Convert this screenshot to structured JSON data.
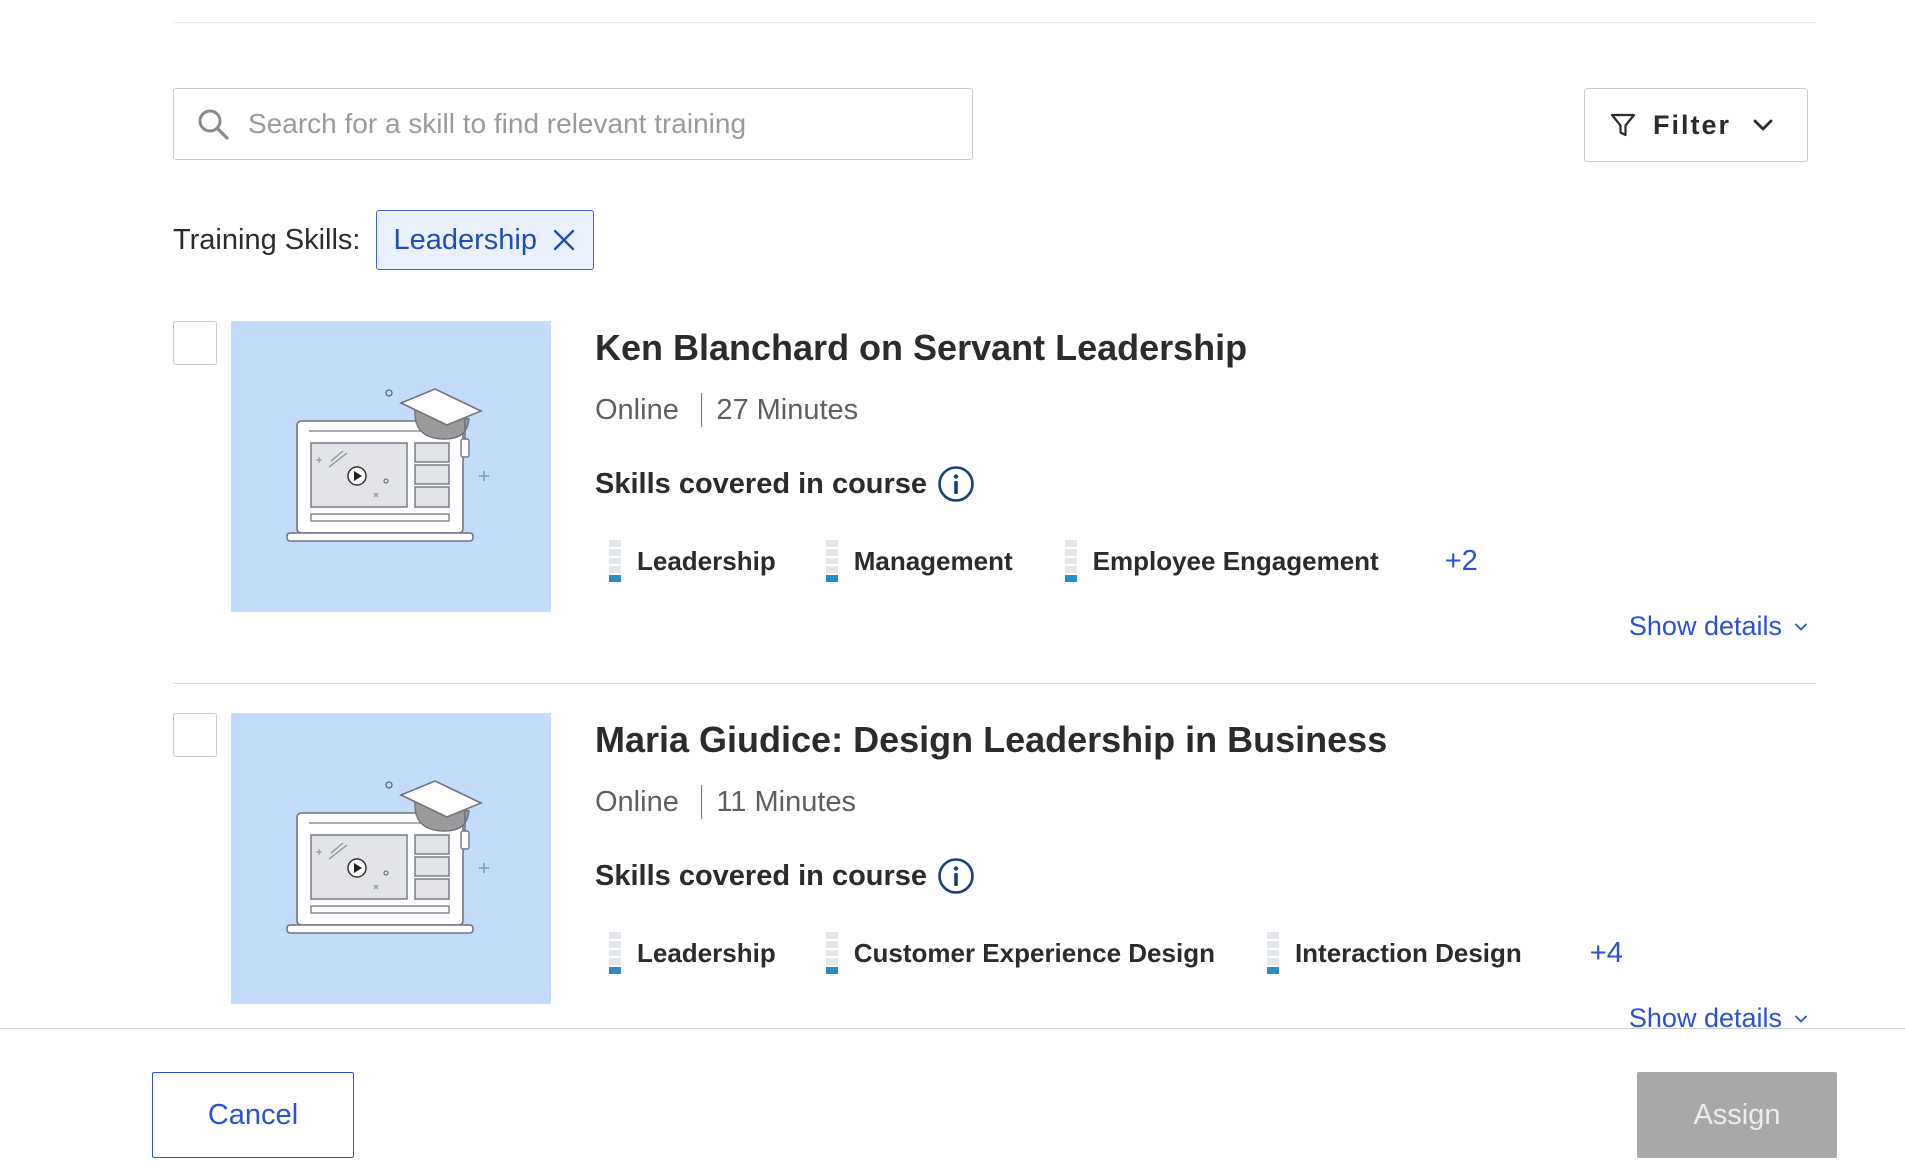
{
  "search": {
    "placeholder": "Search for a skill to find relevant training",
    "value": ""
  },
  "filter": {
    "label": "Filter"
  },
  "training_skills": {
    "label": "Training Skills:",
    "chips": [
      {
        "label": "Leadership"
      }
    ]
  },
  "courses": [
    {
      "title": "Ken Blanchard on Servant Leadership",
      "format": "Online",
      "duration": "27 Minutes",
      "skills_heading": "Skills covered in course",
      "skills": [
        {
          "label": "Leadership",
          "level": 1,
          "max_level": 5
        },
        {
          "label": "Management",
          "level": 1,
          "max_level": 5
        },
        {
          "label": "Employee Engagement",
          "level": 1,
          "max_level": 5
        }
      ],
      "more": "+2",
      "show_details": "Show details"
    },
    {
      "title": "Maria Giudice: Design Leadership in Business",
      "format": "Online",
      "duration": "11 Minutes",
      "skills_heading": "Skills covered in course",
      "skills": [
        {
          "label": "Leadership",
          "level": 1,
          "max_level": 5
        },
        {
          "label": "Customer Experience Design",
          "level": 1,
          "max_level": 5
        },
        {
          "label": "Interaction Design",
          "level": 1,
          "max_level": 5
        }
      ],
      "more": "+4",
      "show_details": "Show details"
    }
  ],
  "footer": {
    "cancel_label": "Cancel",
    "assign_label": "Assign"
  },
  "colors": {
    "accent": "#2b4fd6",
    "chip_border": "#3a66c8",
    "chip_bg": "#eaf1fd",
    "thumb_bg": "#c3dcfc",
    "level_on": "#2a8ec3",
    "assign_disabled": "#a8a8a8"
  },
  "icons": [
    "search-icon",
    "filter-icon",
    "chevron-down-icon",
    "close-icon",
    "info-icon",
    "course-illustration"
  ]
}
